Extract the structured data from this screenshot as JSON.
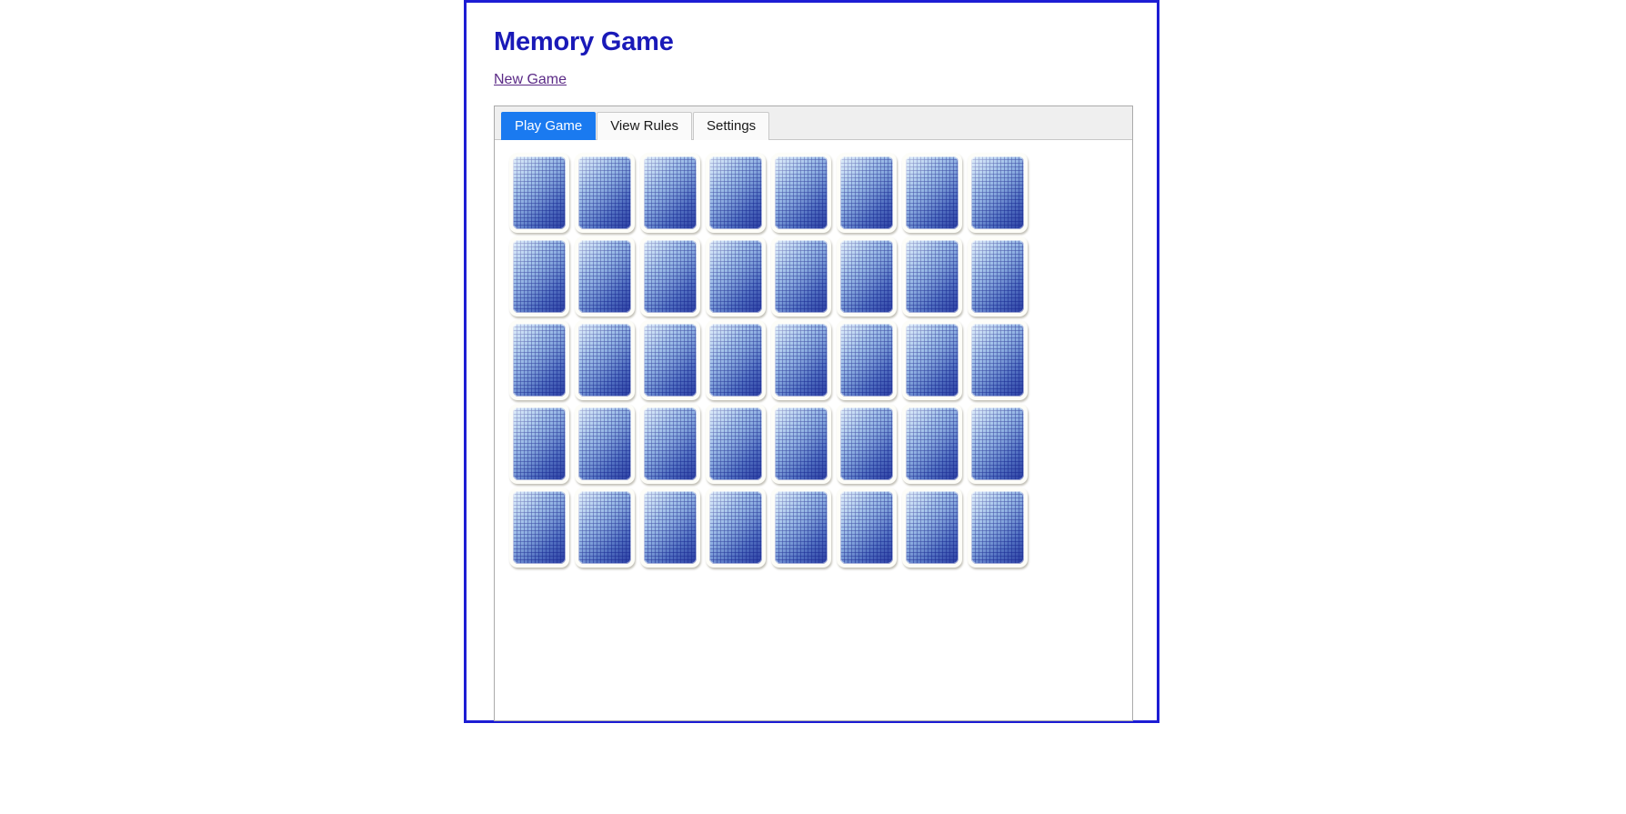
{
  "page": {
    "title": "Memory Game",
    "new_game_label": "New Game",
    "border_color": "#1d1dd4",
    "title_color": "#1a1ab8",
    "link_color": "#5b2a86",
    "background": "#ffffff"
  },
  "tabs": {
    "active_index": 0,
    "active_color": "#1a7af0",
    "items": [
      {
        "label": "Play Game",
        "active": true
      },
      {
        "label": "View Rules",
        "active": false
      },
      {
        "label": "Settings",
        "active": false
      }
    ]
  },
  "board": {
    "rows": 5,
    "columns": 8,
    "total_cards": 40,
    "card_state": "face-down",
    "card_back_pattern": "blue-checkered-plaid",
    "card_back_colors": [
      "#a9cdf0",
      "#7fa8e0",
      "#3c56b4"
    ],
    "card_frame_color": "#fdfdf8",
    "cards": [
      [
        {
          "index": 1,
          "face": "down"
        },
        {
          "index": 2,
          "face": "down"
        },
        {
          "index": 3,
          "face": "down"
        },
        {
          "index": 4,
          "face": "down"
        },
        {
          "index": 5,
          "face": "down"
        },
        {
          "index": 6,
          "face": "down"
        },
        {
          "index": 7,
          "face": "down"
        },
        {
          "index": 8,
          "face": "down"
        }
      ],
      [
        {
          "index": 9,
          "face": "down"
        },
        {
          "index": 10,
          "face": "down"
        },
        {
          "index": 11,
          "face": "down"
        },
        {
          "index": 12,
          "face": "down"
        },
        {
          "index": 13,
          "face": "down"
        },
        {
          "index": 14,
          "face": "down"
        },
        {
          "index": 15,
          "face": "down"
        },
        {
          "index": 16,
          "face": "down"
        }
      ],
      [
        {
          "index": 17,
          "face": "down"
        },
        {
          "index": 18,
          "face": "down"
        },
        {
          "index": 19,
          "face": "down"
        },
        {
          "index": 20,
          "face": "down"
        },
        {
          "index": 21,
          "face": "down"
        },
        {
          "index": 22,
          "face": "down"
        },
        {
          "index": 23,
          "face": "down"
        },
        {
          "index": 24,
          "face": "down"
        }
      ],
      [
        {
          "index": 25,
          "face": "down"
        },
        {
          "index": 26,
          "face": "down"
        },
        {
          "index": 27,
          "face": "down"
        },
        {
          "index": 28,
          "face": "down"
        },
        {
          "index": 29,
          "face": "down"
        },
        {
          "index": 30,
          "face": "down"
        },
        {
          "index": 31,
          "face": "down"
        },
        {
          "index": 32,
          "face": "down"
        }
      ],
      [
        {
          "index": 33,
          "face": "down"
        },
        {
          "index": 34,
          "face": "down"
        },
        {
          "index": 35,
          "face": "down"
        },
        {
          "index": 36,
          "face": "down"
        },
        {
          "index": 37,
          "face": "down"
        },
        {
          "index": 38,
          "face": "down"
        },
        {
          "index": 39,
          "face": "down"
        },
        {
          "index": 40,
          "face": "down"
        }
      ]
    ]
  }
}
